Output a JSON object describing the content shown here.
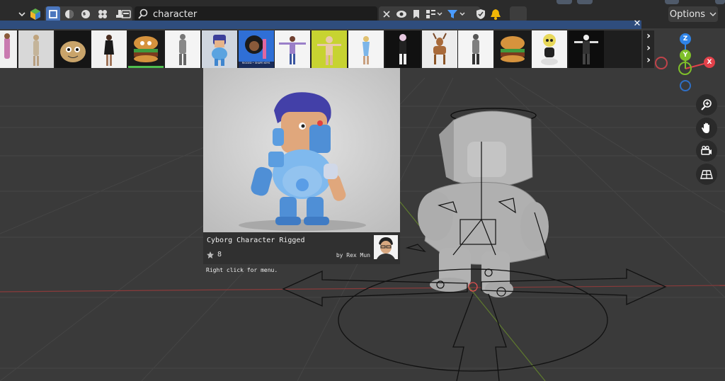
{
  "search": {
    "value": "character"
  },
  "toolbar": {
    "options_label": "Options"
  },
  "asset_strip": {
    "selected_index": 6
  },
  "tooltip": {
    "title": "Cyborg Character Rigged",
    "likes": "8",
    "author": "by Rex Mun",
    "hint": "Right click for menu."
  },
  "thumb_badge": "RIGGED • SHAPE KEYS",
  "gizmo": {
    "z": "Z",
    "y": "Y",
    "x": "X"
  },
  "colors": {
    "accent_blue": "#2f4d7d",
    "filter_blue": "#4a9cff",
    "bell_yellow": "#f2b705",
    "x_axis": "#e2414a",
    "y_axis": "#7fbf2a",
    "z_axis": "#2f83e6"
  }
}
